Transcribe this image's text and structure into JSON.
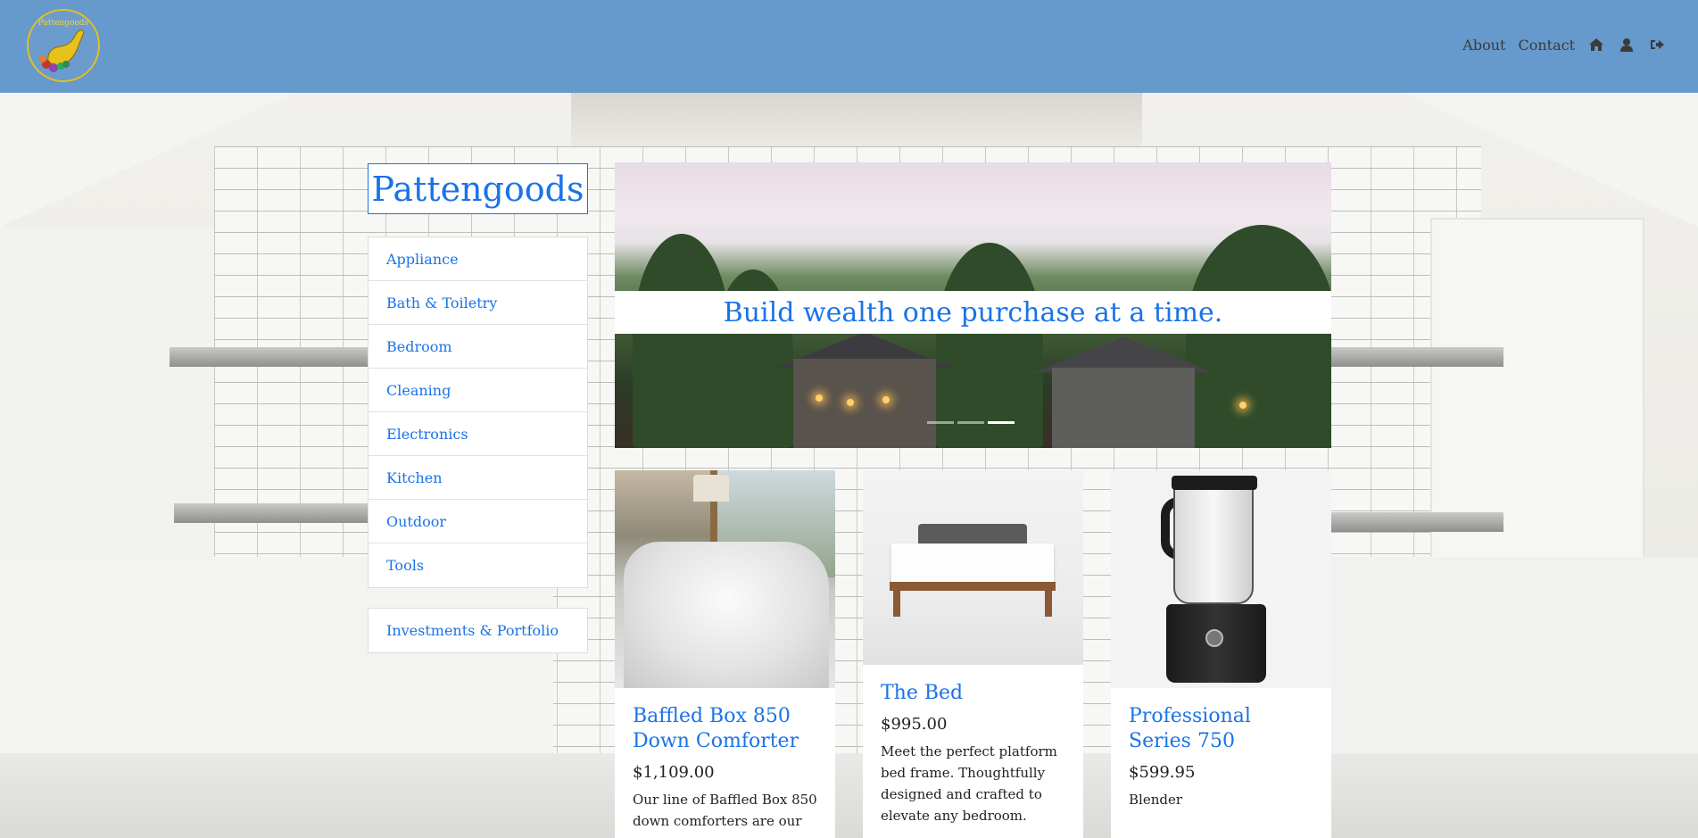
{
  "navbar": {
    "logo_text": "Pattengoods",
    "links": [
      "About",
      "Contact"
    ],
    "icons": [
      "home-icon",
      "user-icon",
      "sign-out-icon"
    ],
    "background": "#6699cc"
  },
  "sidebar": {
    "brand": "Pattengoods",
    "categories": [
      "Appliance",
      "Bath & Toiletry",
      "Bedroom",
      "Cleaning",
      "Electronics",
      "Kitchen",
      "Outdoor",
      "Tools"
    ],
    "investments": "Investments & Portfolio"
  },
  "carousel": {
    "caption": "Build wealth one purchase at a time.",
    "slides": 3,
    "active_slide": 3
  },
  "products": [
    {
      "title": "Baffled Box 850 Down Comforter",
      "price": "$1,109.00",
      "description": "Our line of Baffled Box 850 down comforters are our"
    },
    {
      "title": "The Bed",
      "price": "$995.00",
      "description": "Meet the perfect platform bed frame. Thoughtfully designed and crafted to elevate any bedroom."
    },
    {
      "title": "Professional Series 750",
      "price": "$599.95",
      "description": "Blender"
    }
  ],
  "colors": {
    "accent": "#1a73e8",
    "navbar": "#6699cc",
    "logo_gold": "#e0c020"
  }
}
